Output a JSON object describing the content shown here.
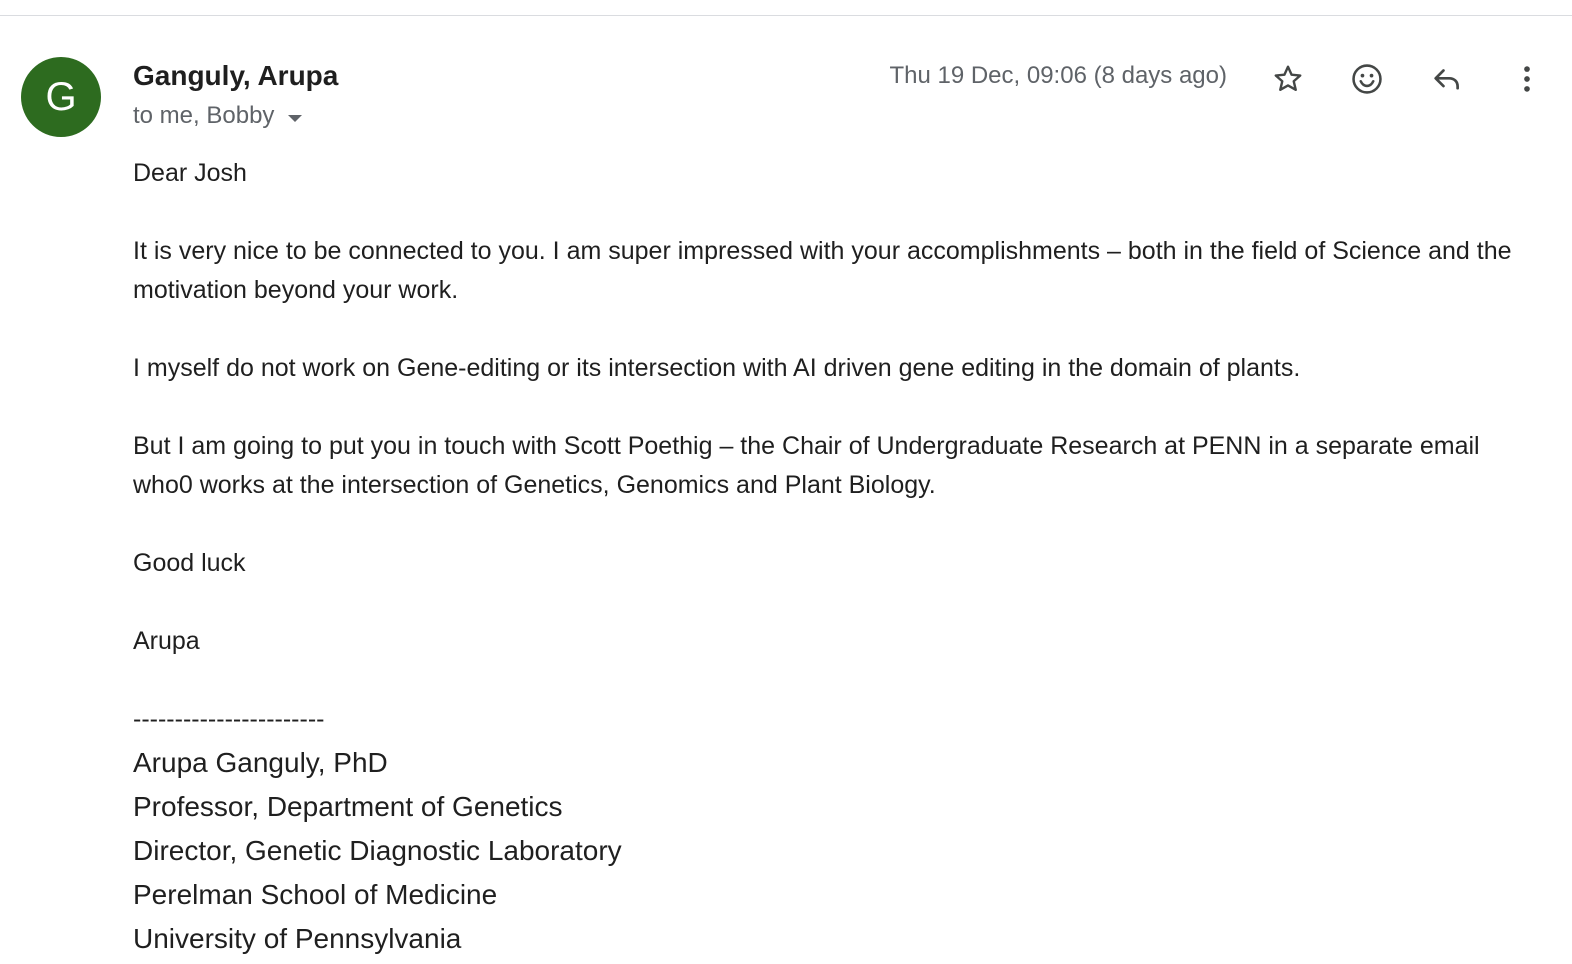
{
  "email": {
    "sender": {
      "avatar_letter": "G",
      "avatar_color": "#2d6b1f",
      "name": "Ganguly, Arupa"
    },
    "recipients_text": "to me, Bobby",
    "timestamp": "Thu 19 Dec, 09:06 (8 days ago)",
    "actions": [
      {
        "icon": "star-icon",
        "label": "Star"
      },
      {
        "icon": "emoji-icon",
        "label": "Add reaction"
      },
      {
        "icon": "reply-icon",
        "label": "Reply"
      },
      {
        "icon": "more-vert-icon",
        "label": "More"
      }
    ],
    "body": {
      "greeting": "Dear Josh",
      "paragraph1": "It is very nice to be connected to you. I am super impressed with your accomplishments – both in the field of Science and the motivation beyond your work.",
      "paragraph2": "I myself do not work on Gene-editing or its intersection with AI driven gene editing in the domain of plants.",
      "paragraph3": "But I am going to put you in touch with Scott Poethig – the Chair of Undergraduate Research at PENN in a separate email who0 works at the intersection of Genetics, Genomics and Plant Biology.",
      "closing": "Good luck",
      "sign_name": "Arupa",
      "separator": "-----------------------"
    },
    "signature": {
      "line1": "Arupa Ganguly, PhD",
      "line2": "Professor, Department of Genetics",
      "line3": "Director, Genetic Diagnostic Laboratory",
      "line4": "Perelman School of Medicine",
      "line5": "University of Pennsylvania"
    }
  }
}
